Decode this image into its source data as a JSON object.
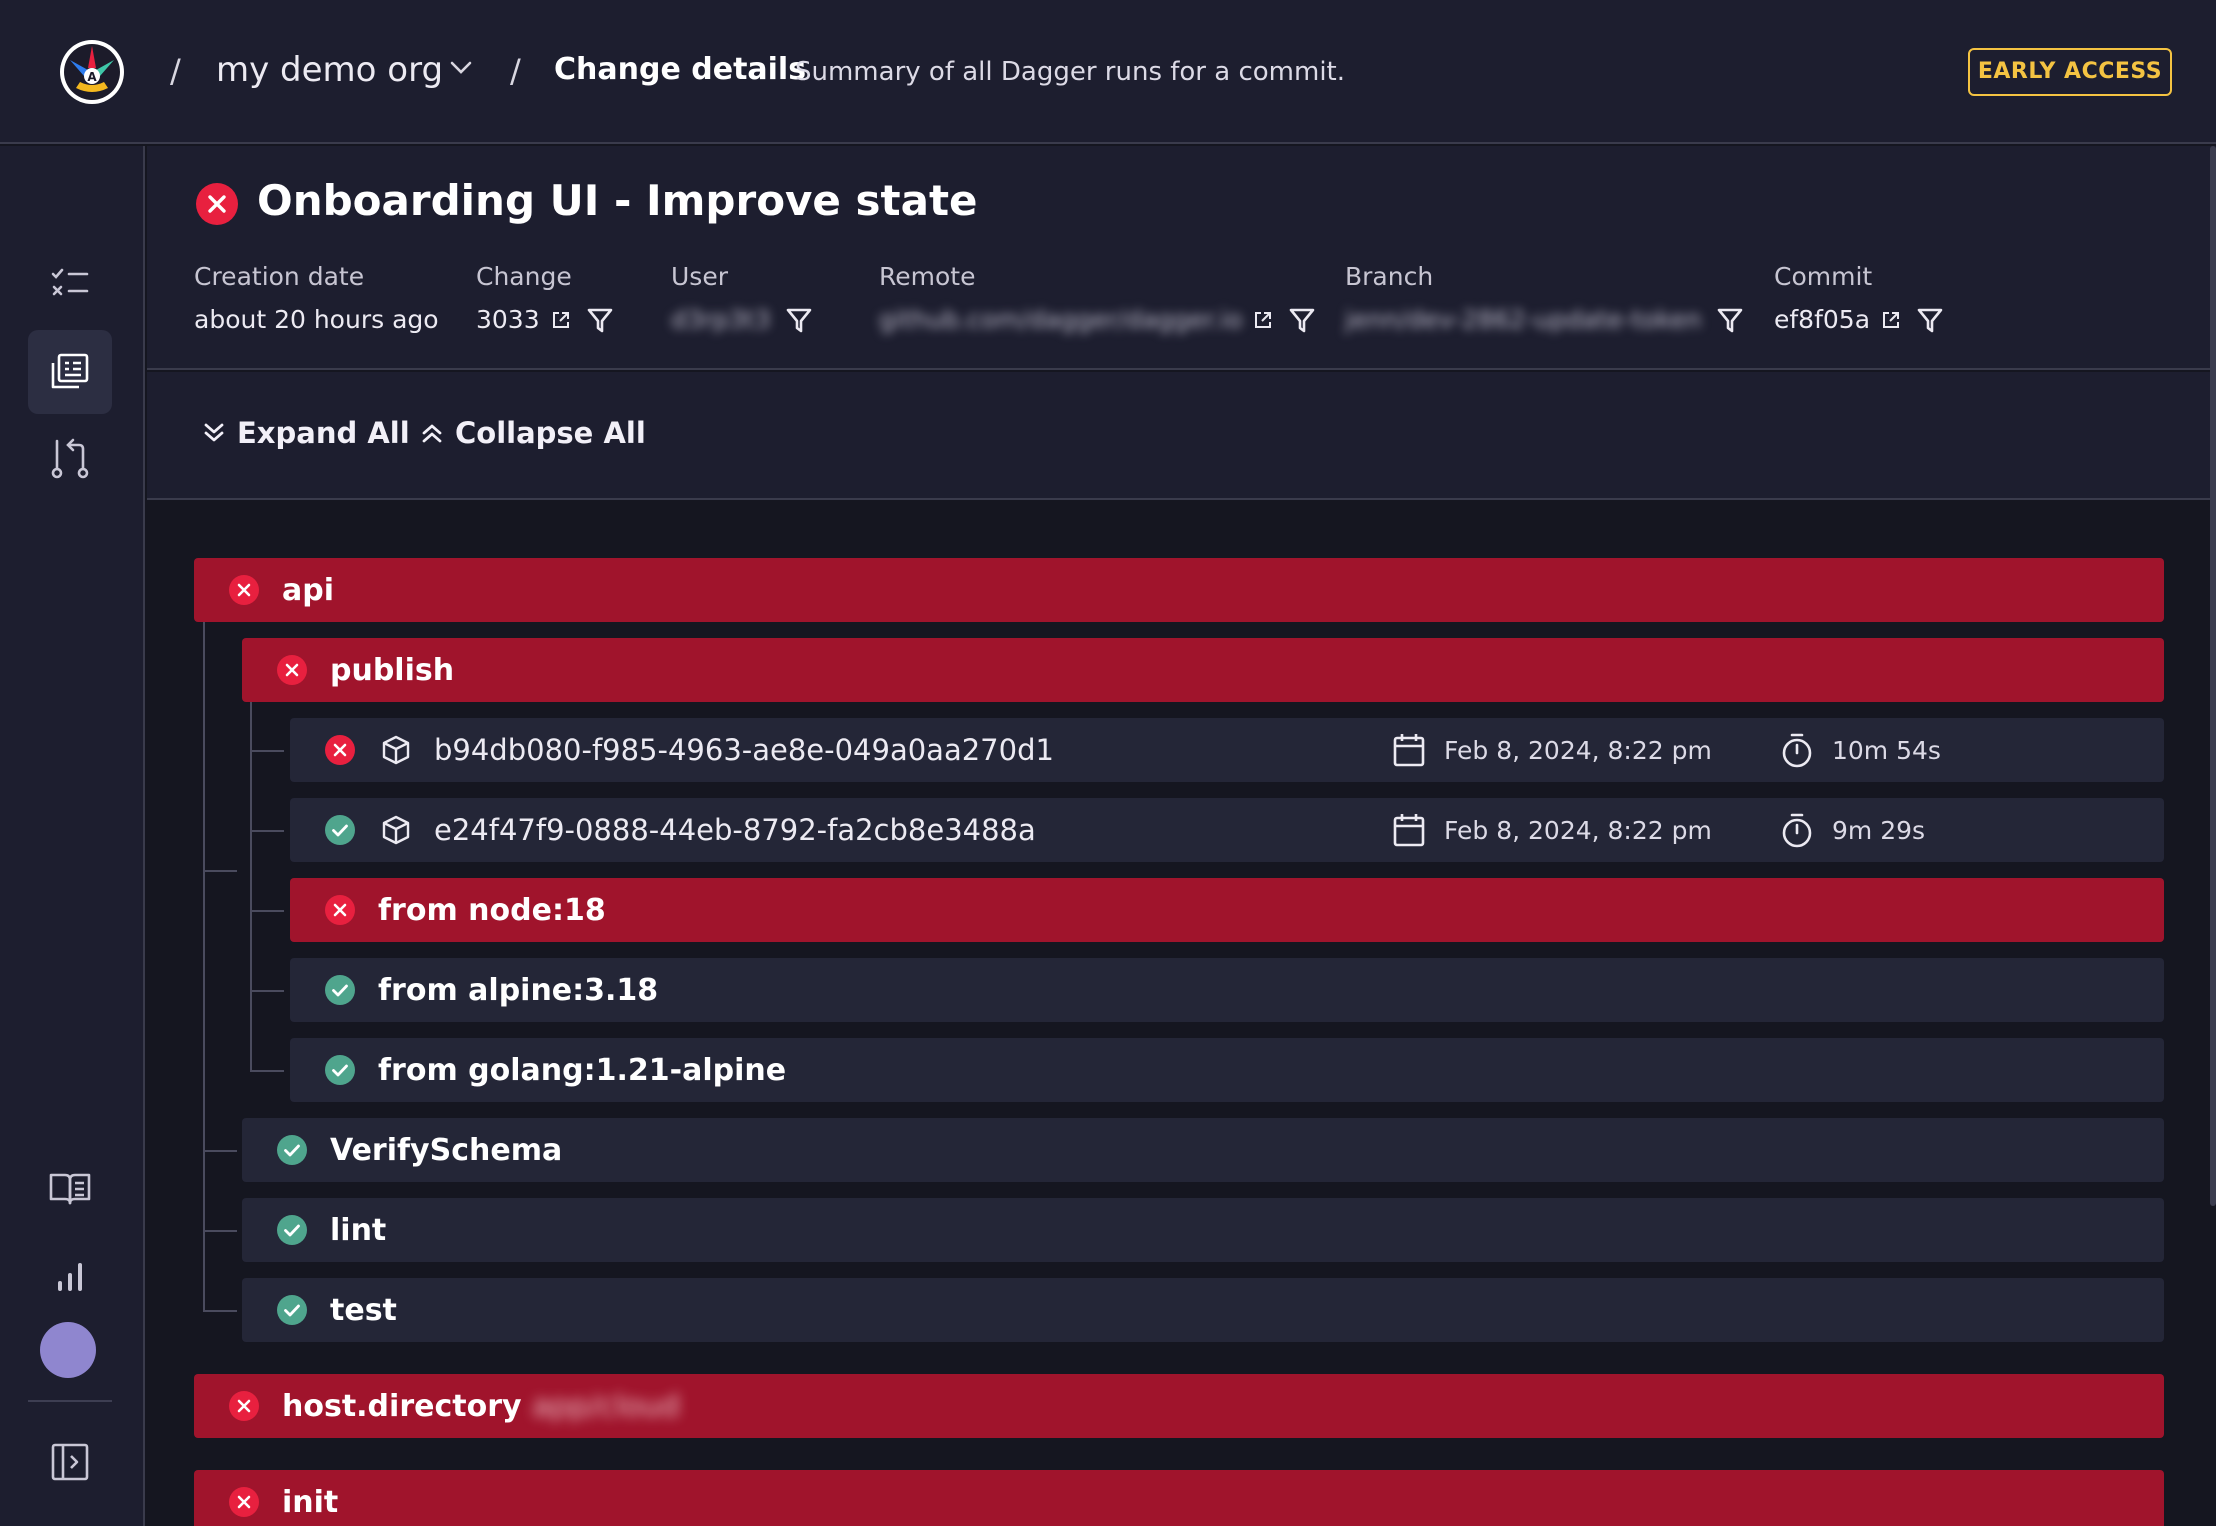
{
  "header": {
    "separator": "/",
    "org_name": "my demo org",
    "page_name": "Change details",
    "page_description": "Summary of all Dagger runs for a commit.",
    "early_access": "EARLY ACCESS"
  },
  "sidebar": {
    "items": [
      {
        "icon": "checklist-icon"
      },
      {
        "icon": "runs-list-icon",
        "active": true
      },
      {
        "icon": "git-compare-icon"
      },
      {
        "icon": "book-icon"
      },
      {
        "icon": "bar-chart-icon"
      },
      {
        "icon": "avatar"
      },
      {
        "icon": "sidebar-toggle-icon"
      }
    ]
  },
  "change": {
    "title": "Onboarding UI - Improve state",
    "status": "failed",
    "meta": {
      "creation_date": {
        "label": "Creation date",
        "value": "about 20 hours ago"
      },
      "change": {
        "label": "Change",
        "value": "3033"
      },
      "user": {
        "label": "User",
        "value": "d3rp3t3"
      },
      "remote": {
        "label": "Remote",
        "value": "github.com/dagger/dagger.io"
      },
      "branch": {
        "label": "Branch",
        "value": "jenn/dev-2862-update-token"
      },
      "commit": {
        "label": "Commit",
        "value": "ef8f05a"
      }
    }
  },
  "toolbar": {
    "expand_all": "Expand All",
    "collapse_all": "Collapse All"
  },
  "tree": {
    "api": {
      "label": "api",
      "status": "failed"
    },
    "publish": {
      "label": "publish",
      "status": "failed"
    },
    "runs": [
      {
        "id": "b94db080-f985-4963-ae8e-049a0aa270d1",
        "status": "failed",
        "date": "Feb 8, 2024, 8:22 pm",
        "duration": "10m 54s"
      },
      {
        "id": "e24f47f9-0888-44eb-8792-fa2cb8e3488a",
        "status": "passed",
        "date": "Feb 8, 2024, 8:22 pm",
        "duration": "9m 29s"
      }
    ],
    "from_node": {
      "label": "from node:18",
      "status": "failed"
    },
    "from_alpine": {
      "label": "from alpine:3.18",
      "status": "passed"
    },
    "from_golang": {
      "label": "from golang:1.21-alpine",
      "status": "passed"
    },
    "verify_schema": {
      "label": "VerifySchema",
      "status": "passed"
    },
    "lint": {
      "label": "lint",
      "status": "passed"
    },
    "test": {
      "label": "test",
      "status": "passed"
    },
    "host_directory": {
      "label": "host.directory",
      "detail": "app/cloud",
      "status": "failed"
    },
    "init": {
      "label": "init",
      "status": "failed"
    }
  },
  "colors": {
    "fail": "#a0142c",
    "fail_icon": "#e8203f",
    "pass_icon": "#4fa58d",
    "accent": "#f4c342",
    "surface": "#1d1e2f",
    "row_bg": "#242637"
  }
}
